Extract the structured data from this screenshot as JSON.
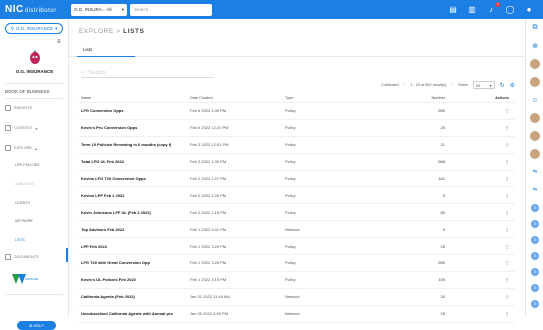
{
  "topbar": {
    "logo": "NIC",
    "logo_sub": "distributor",
    "agency_select": "O.G. INSURA... All",
    "search_placeholder": "Search",
    "notif_count": "2"
  },
  "sidebar": {
    "agency_pill": "O.G. INSURANCE",
    "agency_name": "O.G. INSURANCE",
    "book_of_business": "BOOK OF BUSINESS",
    "insights": "INSIGHTS",
    "content": "CONTENT",
    "explore": "EXPLORE",
    "life_policies": "LIFE POLICIES",
    "annuities": "ANNUITIES",
    "clients": "CLIENTS",
    "network": "NETWORK",
    "lists": "LISTS",
    "documents": "DOCUMENTS",
    "widget_label": "WINSURE",
    "help": "HELP"
  },
  "main": {
    "breadcrumb_parent": "EXPLORE",
    "breadcrumb_sep": ">",
    "breadcrumb_current": "LISTS",
    "tab_label": "Lists",
    "search_placeholder": "Search",
    "selected_text": "0 selected",
    "results_text": "1 - 20 of 592 result(s)",
    "show_label": "Show",
    "show_value": "20",
    "columns": {
      "name": "Name",
      "date": "Date Created",
      "type": "Type",
      "number": "Number",
      "actions": "Actions"
    },
    "rows": [
      {
        "name": "LFG Conversion Opps",
        "date": "Feb 6 2022 1:49 PM",
        "type": "Policy",
        "number": "690"
      },
      {
        "name": "Kevin's Pru Conversion Opps",
        "date": "Feb 6 2022 12:20 PM",
        "type": "Policy",
        "number": "25"
      },
      {
        "name": "Term 10 Policies Renewing in 6 months (copy f)",
        "date": "Feb 3 2022 12:01 PM",
        "type": "Policy",
        "number": "21"
      },
      {
        "name": "Total LFG UL Feb 2022",
        "date": "Feb 2 2022 1:30 PM",
        "type": "Policy",
        "number": "668"
      },
      {
        "name": "Kevins LFG T20 Conversion Opps",
        "date": "Feb 2 2022 1:27 PM",
        "type": "Policy",
        "number": "611"
      },
      {
        "name": "Kevins LPP Feb 2 2022",
        "date": "Feb 2 2022 1:26 PM",
        "type": "Policy",
        "number": "5"
      },
      {
        "name": "Kevin Johnsons LFF UL (Feb 2 2022)",
        "date": "Feb 2 2022 1:18 PM",
        "type": "Policy",
        "number": "89"
      },
      {
        "name": "Top Advisors Feb 2022",
        "date": "Feb 1 2022 3:41 PM",
        "type": "Network",
        "number": "3"
      },
      {
        "name": "LPP Feb 2022",
        "date": "Feb 1 2022 3:29 PM",
        "type": "Policy",
        "number": "25"
      },
      {
        "name": "LFG T20 with Great Conversion Opp",
        "date": "Feb 1 2022 3:25 PM",
        "type": "Policy",
        "number": "690"
      },
      {
        "name": "Kevin's UL Policies Feb 2022",
        "date": "Feb 1 2022 3:19 PM",
        "type": "Policy",
        "number": "155"
      },
      {
        "name": "California Agents (Feb 2022)",
        "date": "Jan 31 2022 11:49 AM",
        "type": "Network",
        "number": "20"
      },
      {
        "name": "Unsubscribed California Agents with Annual pro",
        "date": "Jan 30 2022 8:59 PM",
        "type": "Network",
        "number": "25"
      }
    ]
  },
  "rightrail": {
    "dot_label": "S"
  },
  "colors": {
    "primary": "#1b7fe3",
    "badge": "#e53935"
  }
}
